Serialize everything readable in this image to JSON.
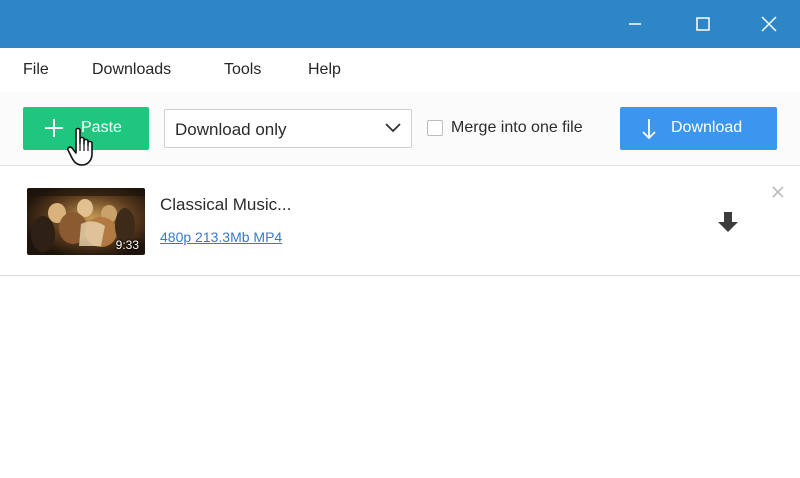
{
  "window": {
    "controls": [
      "minimize-icon",
      "maximize-icon",
      "close-icon"
    ],
    "titlebar_color": "#2f86c6"
  },
  "menu": {
    "items": [
      {
        "label": "File"
      },
      {
        "label": "Downloads"
      },
      {
        "label": "Tools"
      },
      {
        "label": "Help"
      }
    ]
  },
  "toolbar": {
    "paste_label": "Paste",
    "paste_color": "#1ec77d",
    "format_select": {
      "value": "Download only"
    },
    "merge": {
      "label": "Merge into one file",
      "checked": false
    },
    "download_label": "Download",
    "download_color": "#3b96f0"
  },
  "items": [
    {
      "title": "Classical Music...",
      "meta": "480p 213.3Mb MP4",
      "duration": "9:33"
    }
  ]
}
